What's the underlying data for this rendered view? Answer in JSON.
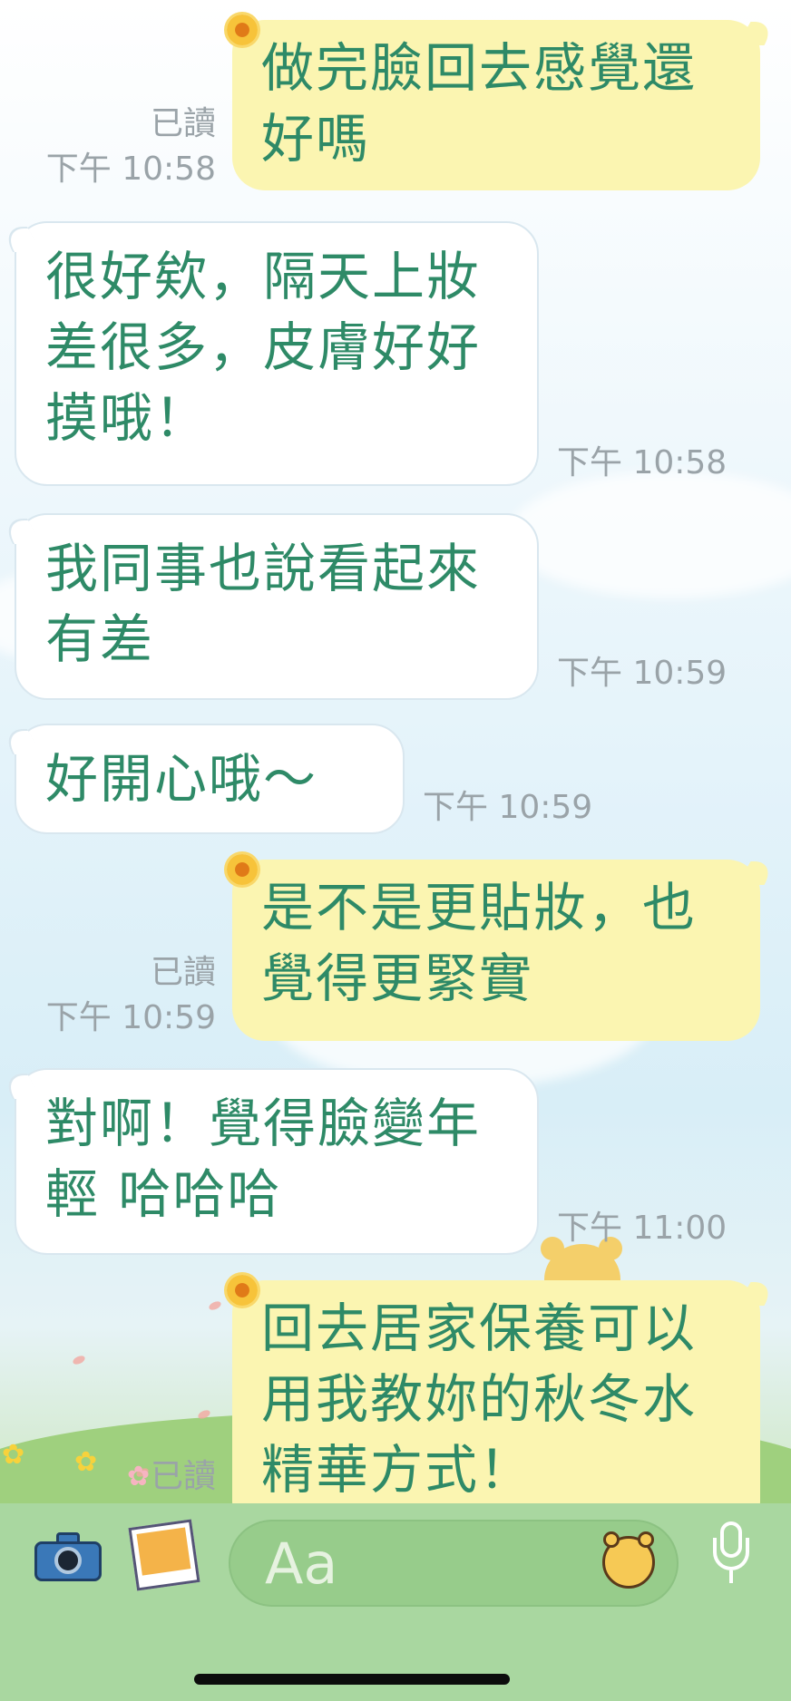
{
  "messages": [
    {
      "side": "out",
      "text": "做完臉回去感覺還好嗎",
      "read": "已讀",
      "time": "下午 10:58"
    },
    {
      "side": "in",
      "text": "很好欸，隔天上妝差很多，皮膚好好摸哦！",
      "time": "下午 10:58"
    },
    {
      "side": "in",
      "text": "我同事也說看起來有差",
      "time": "下午 10:59"
    },
    {
      "side": "in",
      "text": "好開心哦～",
      "time": "下午 10:59"
    },
    {
      "side": "out",
      "text": "是不是更貼妝，也覺得更緊實",
      "read": "已讀",
      "time": "下午 10:59"
    },
    {
      "side": "in",
      "text": "對啊！覺得臉變年輕 哈哈哈",
      "time": "下午 11:00"
    },
    {
      "side": "out",
      "text": "回去居家保養可以用我教妳的秋冬水精華方式！",
      "read": "已讀"
    }
  ],
  "input": {
    "placeholder": "Aa"
  },
  "icons": {
    "camera": "camera-icon",
    "album": "photo-album-icon",
    "sticker": "pooh-sticker-icon",
    "mic": "microphone-icon"
  },
  "colors": {
    "text": "#2e8a67",
    "outgoing": "#fbf5b1",
    "incoming": "#ffffff",
    "bar": "#a9d7a0"
  }
}
